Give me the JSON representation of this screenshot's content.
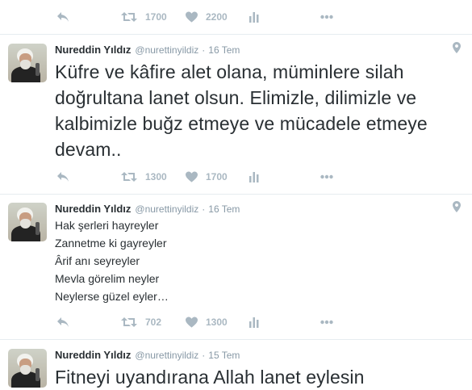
{
  "colors": {
    "icon": "#aab8c2",
    "divider": "#e6ecf0",
    "muted": "#8899a6",
    "text": "#292f33"
  },
  "top_actions": {
    "retweets": "1700",
    "likes": "2200"
  },
  "tweets": [
    {
      "name": "Nureddin Yıldız",
      "handle": "@nurettinyildiz",
      "separator": "·",
      "date": "16 Tem",
      "text": "Küfre ve kâfire alet olana, müminlere silah doğrultana lanet olsun. Elimizle, dilimizle ve kalbimizle buğz etmeye ve mücadele etmeye devam..",
      "retweets": "1300",
      "likes": "1700"
    },
    {
      "name": "Nureddin Yıldız",
      "handle": "@nurettinyildiz",
      "separator": "·",
      "date": "16 Tem",
      "lines": [
        "Hak şerleri hayreyler",
        "Zannetme ki gayreyler",
        "Ârif anı seyreyler",
        "Mevla görelim neyler",
        "Neylerse güzel eyler…"
      ],
      "retweets": "702",
      "likes": "1300"
    },
    {
      "name": "Nureddin Yıldız",
      "handle": "@nurettinyildiz",
      "separator": "·",
      "date": "15 Tem",
      "text": "Fitneyi uyandırana Allah lanet eylesin"
    }
  ],
  "icons": {
    "reply": "reply-icon",
    "retweet": "retweet-icon",
    "like": "heart-icon",
    "analytics": "analytics-icon",
    "more": "more-icon",
    "location": "location-pin-icon"
  }
}
